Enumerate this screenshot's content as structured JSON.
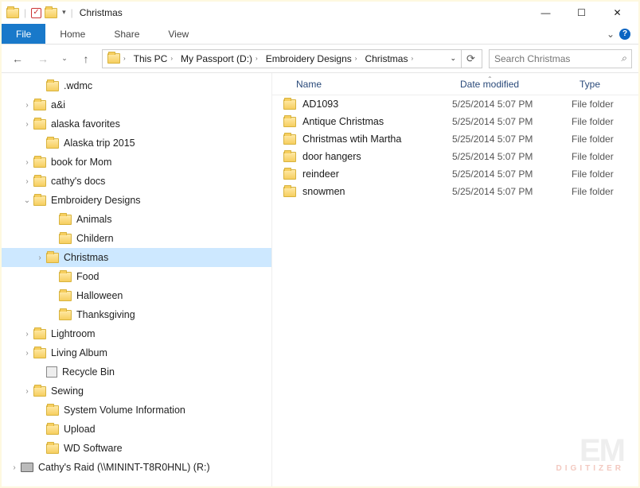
{
  "window": {
    "title": "Christmas",
    "controls": {
      "min": "—",
      "max": "☐",
      "close": "✕"
    }
  },
  "ribbon": {
    "file": "File",
    "tabs": [
      "Home",
      "Share",
      "View"
    ],
    "expand_caret": "⌄"
  },
  "nav": {
    "back": "←",
    "forward": "→",
    "dropdown": "⌄",
    "up": "↑",
    "refresh": "⟳"
  },
  "breadcrumbs": [
    {
      "label": "This PC"
    },
    {
      "label": "My Passport (D:)"
    },
    {
      "label": "Embroidery Designs"
    },
    {
      "label": "Christmas"
    }
  ],
  "search": {
    "placeholder": "Search Christmas",
    "icon": "⌕"
  },
  "tree": [
    {
      "indent": 2,
      "expander": "",
      "label": ".wdmc",
      "icon": "folder"
    },
    {
      "indent": 1,
      "expander": "›",
      "label": "a&i",
      "icon": "folder"
    },
    {
      "indent": 1,
      "expander": "›",
      "label": "alaska favorites",
      "icon": "folder"
    },
    {
      "indent": 2,
      "expander": "",
      "label": "Alaska trip 2015",
      "icon": "folder"
    },
    {
      "indent": 1,
      "expander": "›",
      "label": "book for Mom",
      "icon": "folder"
    },
    {
      "indent": 1,
      "expander": "›",
      "label": "cathy's docs",
      "icon": "folder"
    },
    {
      "indent": 1,
      "expander": "⌄",
      "label": "Embroidery Designs",
      "icon": "folder"
    },
    {
      "indent": 3,
      "expander": "",
      "label": "Animals",
      "icon": "folder"
    },
    {
      "indent": 3,
      "expander": "",
      "label": "Childern",
      "icon": "folder"
    },
    {
      "indent": 2,
      "expander": "›",
      "label": "Christmas",
      "icon": "folder",
      "selected": true
    },
    {
      "indent": 3,
      "expander": "",
      "label": "Food",
      "icon": "folder"
    },
    {
      "indent": 3,
      "expander": "",
      "label": "Halloween",
      "icon": "folder"
    },
    {
      "indent": 3,
      "expander": "",
      "label": "Thanksgiving",
      "icon": "folder"
    },
    {
      "indent": 1,
      "expander": "›",
      "label": "Lightroom",
      "icon": "folder"
    },
    {
      "indent": 1,
      "expander": "›",
      "label": "Living Album",
      "icon": "folder"
    },
    {
      "indent": 2,
      "expander": "",
      "label": "Recycle Bin",
      "icon": "recycle"
    },
    {
      "indent": 1,
      "expander": "›",
      "label": "Sewing",
      "icon": "folder"
    },
    {
      "indent": 2,
      "expander": "",
      "label": "System Volume Information",
      "icon": "folder"
    },
    {
      "indent": 2,
      "expander": "",
      "label": "Upload",
      "icon": "folder"
    },
    {
      "indent": 2,
      "expander": "",
      "label": "WD Software",
      "icon": "folder"
    },
    {
      "indent": 0,
      "expander": "›",
      "label": "Cathy's Raid (\\\\MININT-T8R0HNL) (R:)",
      "icon": "drive"
    }
  ],
  "columns": {
    "name": "Name",
    "date": "Date modified",
    "type": "Type"
  },
  "files": [
    {
      "name": "AD1093",
      "date": "5/25/2014 5:07 PM",
      "type": "File folder"
    },
    {
      "name": "Antique Christmas",
      "date": "5/25/2014 5:07 PM",
      "type": "File folder"
    },
    {
      "name": "Christmas wtih Martha",
      "date": "5/25/2014 5:07 PM",
      "type": "File folder"
    },
    {
      "name": "door hangers",
      "date": "5/25/2014 5:07 PM",
      "type": "File folder"
    },
    {
      "name": "reindeer",
      "date": "5/25/2014 5:07 PM",
      "type": "File folder"
    },
    {
      "name": "snowmen",
      "date": "5/25/2014 5:07 PM",
      "type": "File folder"
    }
  ],
  "watermark": {
    "big": "EM",
    "small": "DIGITIZER"
  }
}
